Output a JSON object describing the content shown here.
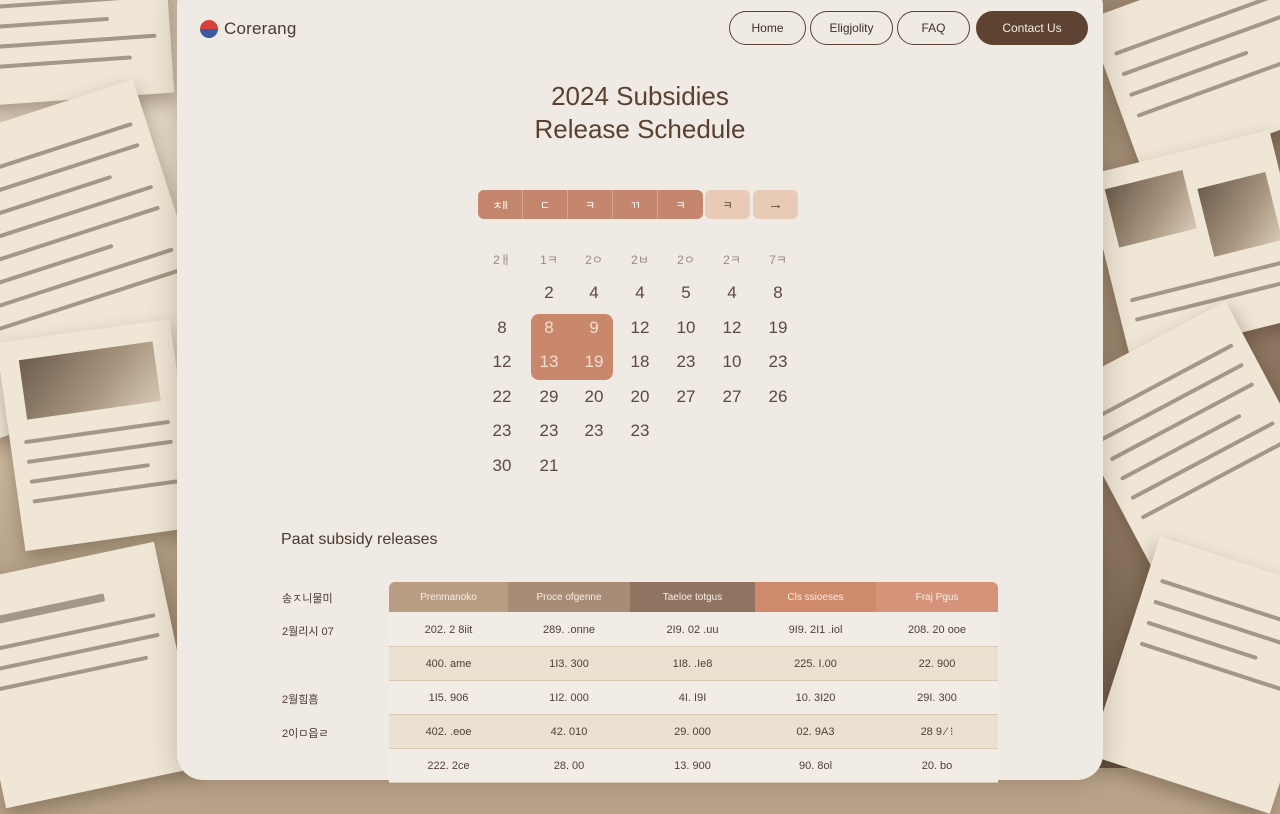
{
  "brand": {
    "name": "Corerang"
  },
  "nav": [
    "Home",
    "Eligjolity",
    "FAQ",
    "Contact Us"
  ],
  "title": {
    "line1": "2024 Subsidies",
    "line2": "Release Schedule"
  },
  "calendar": {
    "tabs": [
      "ㅊll",
      "ㄷ",
      "ㅋ",
      "ㄲ",
      "ㅋ",
      "ㅋ",
      "→"
    ],
    "weekdays": [
      "2ㅐ",
      "1ㅋ",
      "2ㅇ",
      "2ㅂ",
      "2ㅇ",
      "2ㅋ",
      "7ㅋ"
    ],
    "weeks": [
      [
        "",
        "2",
        "4",
        "4",
        "5",
        "4",
        "8"
      ],
      [
        "8",
        "8",
        "9",
        "12",
        "10",
        "12",
        "19"
      ],
      [
        "12",
        "13",
        "19",
        "18",
        "23",
        "10",
        "23"
      ],
      [
        "22",
        "29",
        "20",
        "20",
        "27",
        "27",
        "26"
      ],
      [
        "23",
        "23",
        "23",
        "23",
        "",
        "",
        ""
      ],
      [
        "30",
        "21",
        "",
        "",
        "",
        "",
        ""
      ]
    ]
  },
  "past": {
    "heading": "Paat subsidy releases",
    "row_labels": [
      "송ㅈ니물미",
      "2월리시 07",
      "",
      "2월힘흠",
      "2이ㅁ읍ㄹ"
    ],
    "headers": [
      "Prenmanoko",
      "Proce ofgenne",
      "Taeloe totgus",
      "Cls ssioeses",
      "Fraj Pgus"
    ],
    "rows": [
      [
        "202. 2 8iit",
        "289. .onne",
        "2I9. 02 .uu",
        "9I9. 2I1 .iol",
        "208. 20 ooe"
      ],
      [
        "400. ame",
        "1I3. 300",
        "1I8. .Ie8",
        "225. I.00",
        "22. 900"
      ],
      [
        "1I5. 906",
        "1I2. 000",
        "4I. I9I",
        "10. 3I20",
        "29I. 300"
      ],
      [
        "402. .eoe",
        "42. 010",
        "29. 000",
        "02. 9A3",
        "28 9 ⁄ ⁝"
      ],
      [
        "222. 2ce",
        "28. 00",
        "13. 900",
        "90. 8ol",
        "20. bo"
      ]
    ]
  }
}
